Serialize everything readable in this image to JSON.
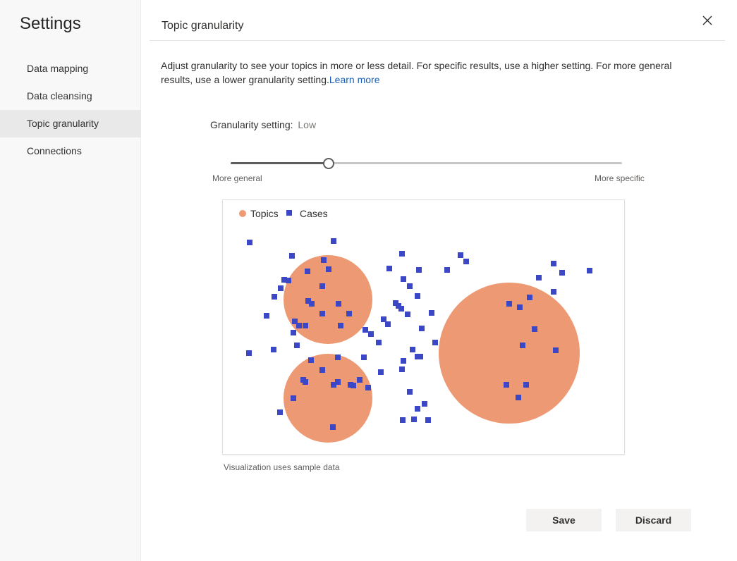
{
  "sidebar": {
    "title": "Settings",
    "items": [
      {
        "label": "Data mapping",
        "active": false
      },
      {
        "label": "Data cleansing",
        "active": false
      },
      {
        "label": "Topic granularity",
        "active": true
      },
      {
        "label": "Connections",
        "active": false
      }
    ]
  },
  "panel": {
    "title": "Topic granularity",
    "description": "Adjust granularity to see your topics in more or less detail. For specific results, use a higher setting. For more general results, use a lower granularity setting.",
    "learn_more": "Learn more",
    "granularity_label": "Granularity setting:",
    "granularity_value": "Low",
    "slider": {
      "min_label": "More general",
      "max_label": "More specific",
      "fraction": 0.25
    },
    "chart_note": "Visualization uses sample data",
    "save_label": "Save",
    "discard_label": "Discard"
  },
  "icons": {
    "close": "close-icon"
  },
  "colors": {
    "topic": "#ed9a74",
    "case": "#3b47c4"
  },
  "chart_data": {
    "type": "scatter",
    "legend": [
      "Topics",
      "Cases"
    ],
    "legend_position": "top-left",
    "x_range": [
      0,
      571
    ],
    "y_range": [
      0,
      362
    ],
    "topics": [
      {
        "cx": 149,
        "cy": 141,
        "r": 63
      },
      {
        "cx": 149,
        "cy": 281,
        "r": 63
      },
      {
        "cx": 406,
        "cy": 217,
        "r": 100
      }
    ],
    "cases": [
      [
        38,
        60
      ],
      [
        157,
        58
      ],
      [
        98,
        79
      ],
      [
        143,
        85
      ],
      [
        120,
        101
      ],
      [
        150,
        98
      ],
      [
        87,
        113
      ],
      [
        93,
        114
      ],
      [
        82,
        125
      ],
      [
        141,
        122
      ],
      [
        73,
        137
      ],
      [
        121,
        143
      ],
      [
        164,
        147
      ],
      [
        126,
        147
      ],
      [
        62,
        164
      ],
      [
        141,
        161
      ],
      [
        179,
        161
      ],
      [
        102,
        172
      ],
      [
        108,
        178
      ],
      [
        117,
        178
      ],
      [
        100,
        188
      ],
      [
        167,
        178
      ],
      [
        100,
        188
      ],
      [
        105,
        206
      ],
      [
        72,
        212
      ],
      [
        37,
        217
      ],
      [
        125,
        227
      ],
      [
        163,
        223
      ],
      [
        141,
        241
      ],
      [
        114,
        255
      ],
      [
        117,
        258
      ],
      [
        157,
        262
      ],
      [
        185,
        263
      ],
      [
        163,
        258
      ],
      [
        194,
        255
      ],
      [
        206,
        266
      ],
      [
        181,
        262
      ],
      [
        100,
        281
      ],
      [
        81,
        301
      ],
      [
        156,
        322
      ],
      [
        254,
        76
      ],
      [
        236,
        97
      ],
      [
        278,
        99
      ],
      [
        256,
        112
      ],
      [
        265,
        122
      ],
      [
        276,
        136
      ],
      [
        245,
        146
      ],
      [
        249,
        150
      ],
      [
        253,
        154
      ],
      [
        296,
        160
      ],
      [
        262,
        162
      ],
      [
        228,
        169
      ],
      [
        234,
        176
      ],
      [
        202,
        184
      ],
      [
        210,
        190
      ],
      [
        221,
        202
      ],
      [
        282,
        182
      ],
      [
        269,
        212
      ],
      [
        280,
        222
      ],
      [
        276,
        222
      ],
      [
        254,
        240
      ],
      [
        256,
        228
      ],
      [
        224,
        244
      ],
      [
        200,
        223
      ],
      [
        301,
        202
      ],
      [
        318,
        99
      ],
      [
        337,
        78
      ],
      [
        345,
        87
      ],
      [
        469,
        90
      ],
      [
        481,
        103
      ],
      [
        520,
        100
      ],
      [
        448,
        110
      ],
      [
        469,
        130
      ],
      [
        265,
        272
      ],
      [
        286,
        289
      ],
      [
        276,
        296
      ],
      [
        255,
        312
      ],
      [
        271,
        311
      ],
      [
        291,
        312
      ],
      [
        406,
        147
      ],
      [
        421,
        152
      ],
      [
        435,
        138
      ],
      [
        442,
        183
      ],
      [
        425,
        206
      ],
      [
        472,
        213
      ],
      [
        402,
        262
      ],
      [
        430,
        262
      ],
      [
        419,
        280
      ]
    ]
  }
}
